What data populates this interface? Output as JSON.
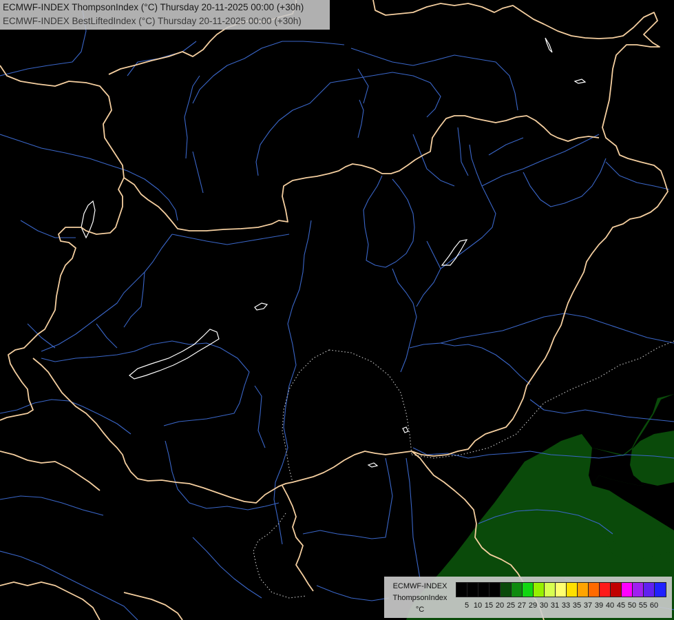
{
  "header": {
    "line1": "ECMWF-INDEX ThompsonIndex (°C) Thursday 20-11-2025 00:00 (+30h)",
    "line2": "ECMWF-INDEX BestLiftedIndex (°C) Thursday 20-11-2025 00:00 (+30h)"
  },
  "legend": {
    "title_model": "ECMWF-INDEX",
    "title_param": "ThompsonIndex",
    "title_unit": "°C",
    "ticks": [
      "5",
      "10",
      "15",
      "20",
      "25",
      "27",
      "29",
      "30",
      "31",
      "33",
      "35",
      "37",
      "39",
      "40",
      "45",
      "50",
      "55",
      "60"
    ],
    "colors": [
      "#000000",
      "#000000",
      "#000000",
      "#000000",
      "#0a4a0a",
      "#0f8a0f",
      "#12d612",
      "#96f000",
      "#d8ff50",
      "#ffff70",
      "#ffe000",
      "#ffa400",
      "#ff6a00",
      "#ff1a1a",
      "#c00000",
      "#ff00ff",
      "#a020f0",
      "#6020f0",
      "#2020ff"
    ]
  },
  "map": {
    "background_color": "#000000",
    "border_color": "#f5cfa0",
    "river_color": "#3a66c8",
    "lake_color": "#ffffff",
    "field_color": "#0a4a0a"
  }
}
